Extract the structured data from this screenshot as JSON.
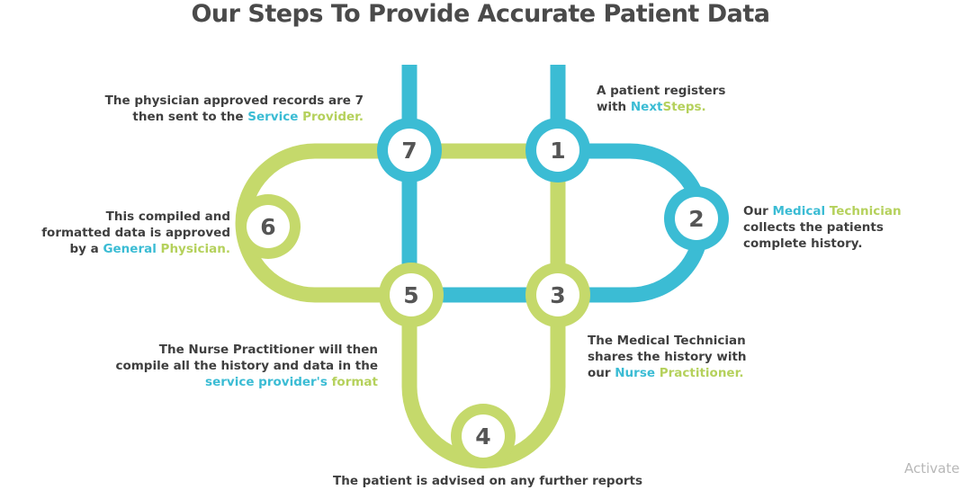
{
  "title": "Our Steps To Provide Accurate Patient Data",
  "colors": {
    "teal": "#3bbcd4",
    "lime": "#c5d96b",
    "number": "#555555",
    "text": "#3f3f3f"
  },
  "nodes": [
    "1",
    "2",
    "3",
    "4",
    "5",
    "6",
    "7"
  ],
  "steps": {
    "s1": {
      "l1a": "A patient registers",
      "l2a": "with ",
      "l2b": "Next",
      "l2c": "Steps."
    },
    "s2": {
      "l1a": "Our ",
      "l1b": "Medical",
      "l1c": " ",
      "l1d": "Technician",
      "l2": "collects the patients",
      "l3": "complete history."
    },
    "s3": {
      "l1": "The Medical Technician",
      "l2": "shares the history with",
      "l3a": "our ",
      "l3b": "Nurse",
      "l3c": " ",
      "l3d": "Practitioner."
    },
    "s4": {
      "l1": "The patient is advised on any further reports"
    },
    "s5": {
      "l1": "The Nurse Practitioner will then",
      "l2": "compile all the history and data in the",
      "l3a": "service provider's",
      "l3b": " ",
      "l3c": "format"
    },
    "s6": {
      "l1": "This compiled and",
      "l2": "formatted data is approved",
      "l3a": "by a ",
      "l3b": "General",
      "l3c": " ",
      "l3d": "Physician."
    },
    "s7": {
      "l1": "The physician approved records are 7",
      "l2a": "then sent to the ",
      "l2b": "Service",
      "l2c": " ",
      "l2d": "Provider."
    }
  },
  "watermark": "Activate"
}
